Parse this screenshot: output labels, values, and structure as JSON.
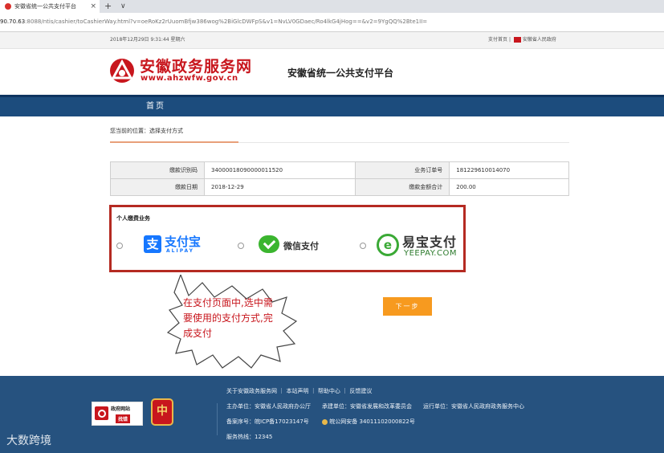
{
  "browser": {
    "tab_title": "安徽省统一公共支付平台",
    "tab_close": "×",
    "new_tab": "+",
    "tab_menu": "∨",
    "address_host": "90.70.63",
    "address_rest": ":8088/ntis/cashier/toCashierWay.html?v=oeRoKz2rUuomBfjw386wog%2BiGlcDWFpS&v1=NvLV0GDaec/Ro4lkG4jHog==&v2=9YgQQ%2Bte1II="
  },
  "topbar": {
    "datetime": "2018年12月29日 9:31:44 星期六",
    "pay_home": "支付首页",
    "separator": "|",
    "gov_link": "安徽省人民政府"
  },
  "header": {
    "brand_name": "安徽政务服务网",
    "brand_url": "www.ahzwfw.gov.cn",
    "platform_title": "安徽省统一公共支付平台"
  },
  "nav": {
    "home": "首页"
  },
  "breadcrumb": "您当前的位置：选择支付方式",
  "order": {
    "rows": [
      {
        "label1": "缴款识别码",
        "value1": "340000180900000115​20",
        "label2": "业务订单号",
        "value2": "181229610014070"
      },
      {
        "label1": "缴款日期",
        "value1": "2018-12-29",
        "label2": "缴款金额合计",
        "value2": "200.00"
      }
    ]
  },
  "payment": {
    "section_label": "个人缴费业务",
    "alipay": {
      "icon_char": "支",
      "name": "支付宝",
      "sub": "ALIPAY"
    },
    "wechat": {
      "name": "微信支付"
    },
    "yeepay": {
      "icon_char": "e",
      "name": "易宝支付",
      "sub": "YEEPAY.COM"
    }
  },
  "callout_text": "在支付页面中,选中需要使用的支付方式,完成支付",
  "next_button": "下一步",
  "footer": {
    "links": "关于安徽政务服务网 ｜ 本站声明 ｜ 帮助中心 ｜ 反馈建议",
    "sponsor": "主办单位：安徽省人民政府办公厅　　承建单位：安徽省发展和改革委员会　　运行单位：安徽省人民政府政务服务中心",
    "icp": "备案序号：皖ICP备17023147号",
    "police": "皖公网安备 34011102000822号",
    "hotline": "服务热线：12345",
    "findbug_top": "政府网站",
    "findbug_bot": "找错",
    "seal_char": "中"
  },
  "watermark": "大数跨境"
}
